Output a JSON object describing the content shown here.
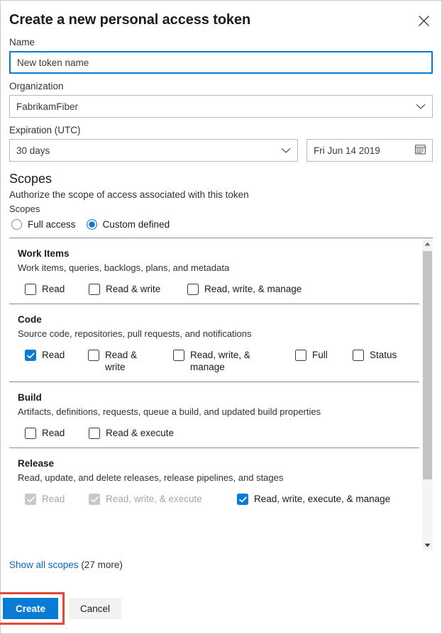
{
  "dialog": {
    "title": "Create a new personal access token",
    "close_icon": "close-icon"
  },
  "form": {
    "name_label": "Name",
    "name_value": "New token name",
    "name_placeholder": "New token name",
    "organization_label": "Organization",
    "organization_value": "FabrikamFiber",
    "expiration_label": "Expiration (UTC)",
    "expiration_value": "30 days",
    "expiration_date": "Fri Jun 14 2019",
    "calendar_icon": "calendar-icon",
    "chevron_icon": "chevron-down-icon"
  },
  "scopes": {
    "heading": "Scopes",
    "description": "Authorize the scope of access associated with this token",
    "radio_group_label": "Scopes",
    "radios": [
      {
        "label": "Full access",
        "checked": false
      },
      {
        "label": "Custom defined",
        "checked": true
      }
    ],
    "groups": [
      {
        "name": "Work Items",
        "description": "Work items, queries, backlogs, plans, and metadata",
        "options": [
          {
            "label": "Read",
            "checked": false,
            "disabled": false
          },
          {
            "label": "Read & write",
            "checked": false,
            "disabled": false
          },
          {
            "label": "Read, write, & manage",
            "checked": false,
            "disabled": false
          }
        ]
      },
      {
        "name": "Code",
        "description": "Source code, repositories, pull requests, and notifications",
        "options": [
          {
            "label": "Read",
            "checked": true,
            "disabled": false
          },
          {
            "label": "Read & write",
            "checked": false,
            "disabled": false
          },
          {
            "label": "Read, write, & manage",
            "checked": false,
            "disabled": false
          },
          {
            "label": "Full",
            "checked": false,
            "disabled": false
          },
          {
            "label": "Status",
            "checked": false,
            "disabled": false
          }
        ]
      },
      {
        "name": "Build",
        "description": "Artifacts, definitions, requests, queue a build, and updated build properties",
        "options": [
          {
            "label": "Read",
            "checked": false,
            "disabled": false
          },
          {
            "label": "Read & execute",
            "checked": false,
            "disabled": false
          }
        ]
      },
      {
        "name": "Release",
        "description": "Read, update, and delete releases, release pipelines, and stages",
        "options": [
          {
            "label": "Read",
            "checked": true,
            "disabled": true
          },
          {
            "label": "Read, write, & execute",
            "checked": true,
            "disabled": true
          },
          {
            "label": "Read, write, execute, & manage",
            "checked": true,
            "disabled": false
          }
        ]
      }
    ],
    "show_all_link": "Show all scopes",
    "show_all_count": " (27 more)"
  },
  "footer": {
    "create_label": "Create",
    "cancel_label": "Cancel"
  },
  "colors": {
    "accent": "#0a7bd4",
    "link": "#0a66c2",
    "highlight": "#e8453c",
    "disabled_checkbox": "#c8c8c8",
    "border": "#b9b9b9"
  }
}
